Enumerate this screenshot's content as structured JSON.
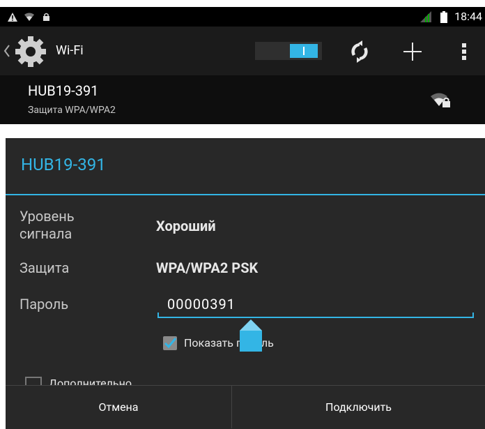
{
  "status_bar": {
    "clock": "18:44",
    "icons": [
      "warning-icon",
      "wifi-signal-icon",
      "lock-icon",
      "cellular-signal-icon",
      "battery-icon"
    ]
  },
  "action_bar": {
    "title": "Wi-Fi",
    "wifi_enabled": true,
    "icons": [
      "back-icon",
      "settings-gear-icon",
      "wps-icon",
      "add-icon",
      "overflow-menu-icon"
    ]
  },
  "network_row": {
    "ssid": "HUB19-391",
    "security": "Защита WPA/WPA2"
  },
  "dialog": {
    "title": "HUB19-391",
    "signal_label": "Уровень сигнала",
    "signal_value": "Хороший",
    "security_label": "Защита",
    "security_value": "WPA/WPA2 PSK",
    "password_label": "Пароль",
    "password_value": "00000391",
    "show_password_label": "Показать пароль",
    "show_password_checked": true,
    "advanced_label": "Дополнительно",
    "cancel_label": "Отмена",
    "connect_label": "Подключить"
  },
  "colors": {
    "accent": "#33b5e5",
    "dialog_bg": "#282828",
    "actionbar_bg": "#1b1b1b"
  }
}
